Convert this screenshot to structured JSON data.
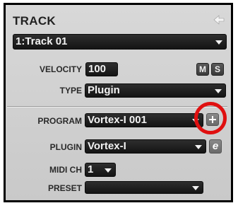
{
  "panel": {
    "title": "TRACK",
    "track_select": {
      "value": "1:Track 01"
    },
    "velocity": {
      "label": "VELOCITY",
      "value": "100"
    },
    "mute_label": "M",
    "solo_label": "S",
    "type": {
      "label": "TYPE",
      "value": "Plugin"
    },
    "program": {
      "label": "PROGRAM",
      "value": "Vortex-I 001"
    },
    "plugin": {
      "label": "PLUGIN",
      "value": "Vortex-I"
    },
    "edit_label": "e",
    "midi_ch": {
      "label": "MIDI CH",
      "value": "1"
    },
    "preset": {
      "label": "PRESET",
      "value": ""
    }
  },
  "icons": {
    "back": "back-arrow-icon",
    "dropdown": "dropdown-arrow-icon",
    "add_program": "plus-icon"
  },
  "colors": {
    "highlight_ring": "#e01010",
    "field_background": "#1e1e1e",
    "panel_background": "#d0d0d0"
  }
}
